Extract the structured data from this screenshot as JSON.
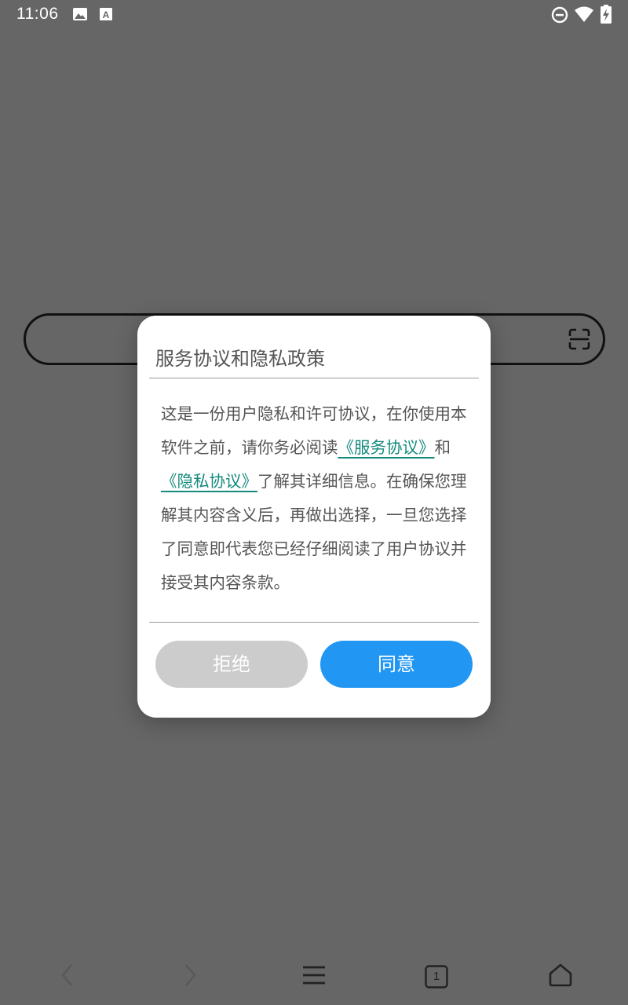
{
  "status_bar": {
    "time": "11:06",
    "left_icons": [
      "image-icon",
      "font-a-icon"
    ],
    "right_icons": [
      "do-not-disturb-icon",
      "wifi-icon",
      "battery-charging-icon"
    ]
  },
  "search_bar": {
    "icon": "scan-icon"
  },
  "dialog": {
    "title": "服务协议和隐私政策",
    "body": {
      "part1": "这是一份用户隐私和许可协议，在你使用本软件之前，请你务必阅读",
      "service_link": "《服务协议》",
      "part2": "和 ",
      "privacy_link": "《隐私协议》",
      "part3": "了解其详细信息。在确保您理解其内容含义后，再做出选择，一旦您选择了同意即代表您已经仔细阅读了用户协议并接受其内容条款。"
    },
    "reject_label": "拒绝",
    "agree_label": "同意",
    "colors": {
      "link": "#138a7c",
      "agree": "#2196f3",
      "reject": "#cccccc"
    }
  },
  "bottom_nav": {
    "tab_count": "1",
    "icons": [
      "back-icon",
      "forward-icon",
      "menu-icon",
      "tabs-icon",
      "home-icon"
    ]
  }
}
